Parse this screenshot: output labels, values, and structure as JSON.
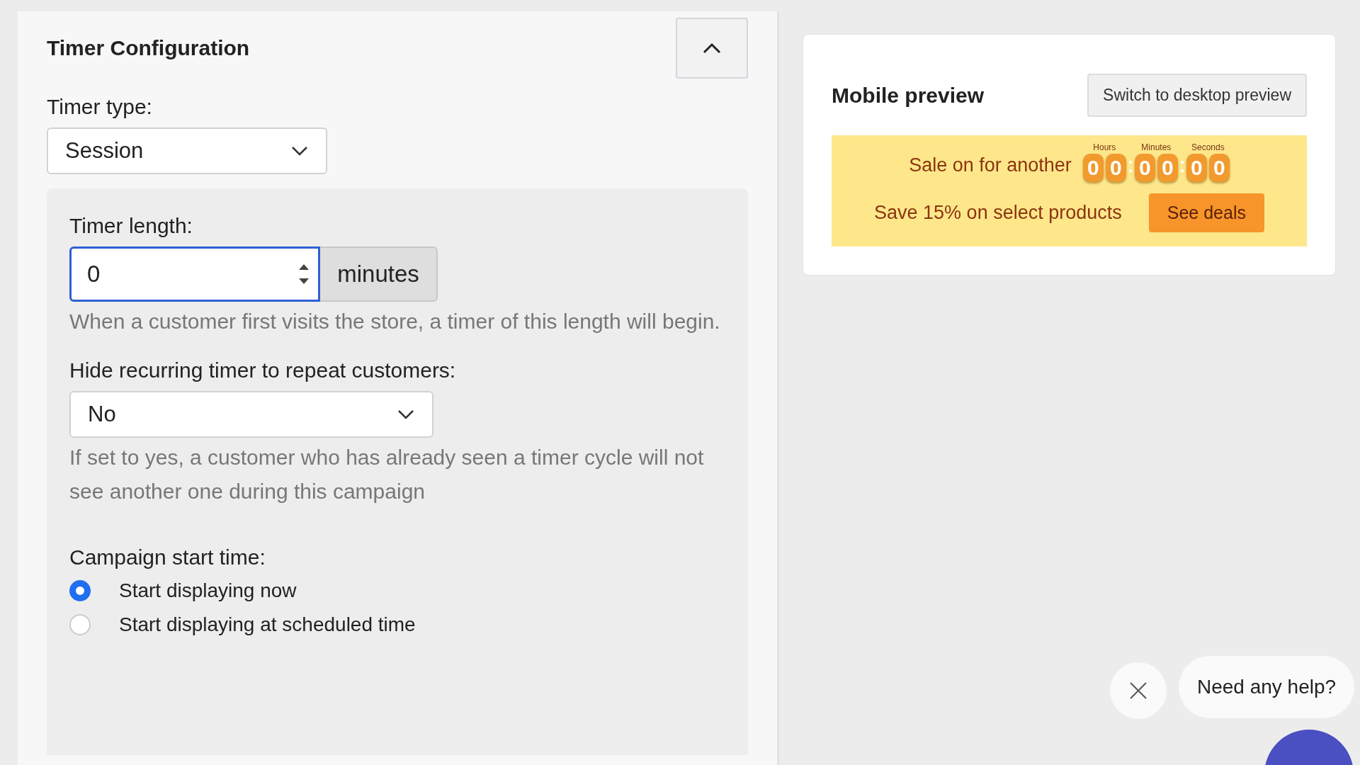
{
  "config": {
    "title": "Timer Configuration",
    "expanded": true,
    "timer_type": {
      "label": "Timer type:",
      "value": "Session"
    },
    "timer_length": {
      "label": "Timer length:",
      "value": "0",
      "unit": "minutes",
      "help": "When a customer first visits the store, a timer of this length will begin."
    },
    "hide_recurring": {
      "label": "Hide recurring timer to repeat customers:",
      "value": "No",
      "help": "If set to yes, a customer who has already seen a timer cycle will not see another one during this campaign"
    },
    "start_time": {
      "label": "Campaign start time:",
      "options": [
        {
          "label": "Start displaying now",
          "selected": true
        },
        {
          "label": "Start displaying at scheduled time",
          "selected": false
        }
      ]
    }
  },
  "preview": {
    "title": "Mobile preview",
    "switch_button": "Switch to desktop preview",
    "banner": {
      "countdown_text": "Sale on for another",
      "units": [
        {
          "label": "Hours",
          "digits": [
            "0",
            "0"
          ]
        },
        {
          "label": "Minutes",
          "digits": [
            "0",
            "0"
          ]
        },
        {
          "label": "Seconds",
          "digits": [
            "0",
            "0"
          ]
        }
      ],
      "offer_text": "Save 15% on select products",
      "button": "See deals"
    }
  },
  "chat": {
    "prompt": "Need any help?"
  }
}
